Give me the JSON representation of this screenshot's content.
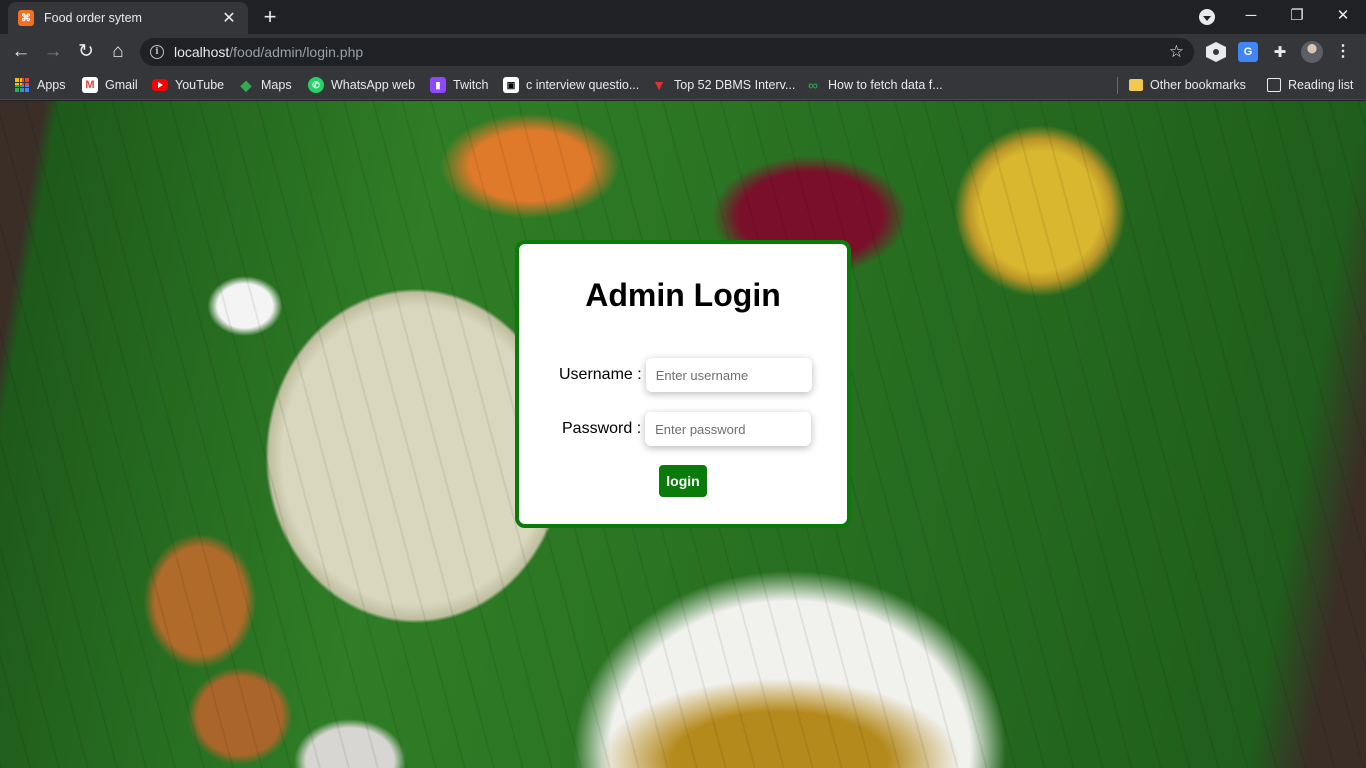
{
  "browser": {
    "tab": {
      "favicon": "xampp-icon",
      "title": "Food order sytem"
    },
    "url": {
      "host": "localhost",
      "path": "/food/admin/login.php"
    },
    "bookmarks": [
      {
        "label": "Apps",
        "icon": "apps-grid-icon"
      },
      {
        "label": "Gmail",
        "icon": "gmail-icon"
      },
      {
        "label": "YouTube",
        "icon": "youtube-icon"
      },
      {
        "label": "Maps",
        "icon": "maps-icon"
      },
      {
        "label": "WhatsApp web",
        "icon": "whatsapp-icon"
      },
      {
        "label": "Twitch",
        "icon": "twitch-icon"
      },
      {
        "label": "c interview questio...",
        "icon": "c-interview-icon"
      },
      {
        "label": "Top 52 DBMS Interv...",
        "icon": "dbms-icon"
      },
      {
        "label": "How to fetch data f...",
        "icon": "fetch-data-icon"
      }
    ],
    "other_bookmarks": "Other bookmarks",
    "reading_list": "Reading list"
  },
  "login": {
    "title": "Admin Login",
    "username_label": "Username :",
    "username_placeholder": "Enter username",
    "password_label": "Password :",
    "password_placeholder": "Enter password",
    "button_label": "login",
    "accent_color": "#0b7a0b"
  }
}
